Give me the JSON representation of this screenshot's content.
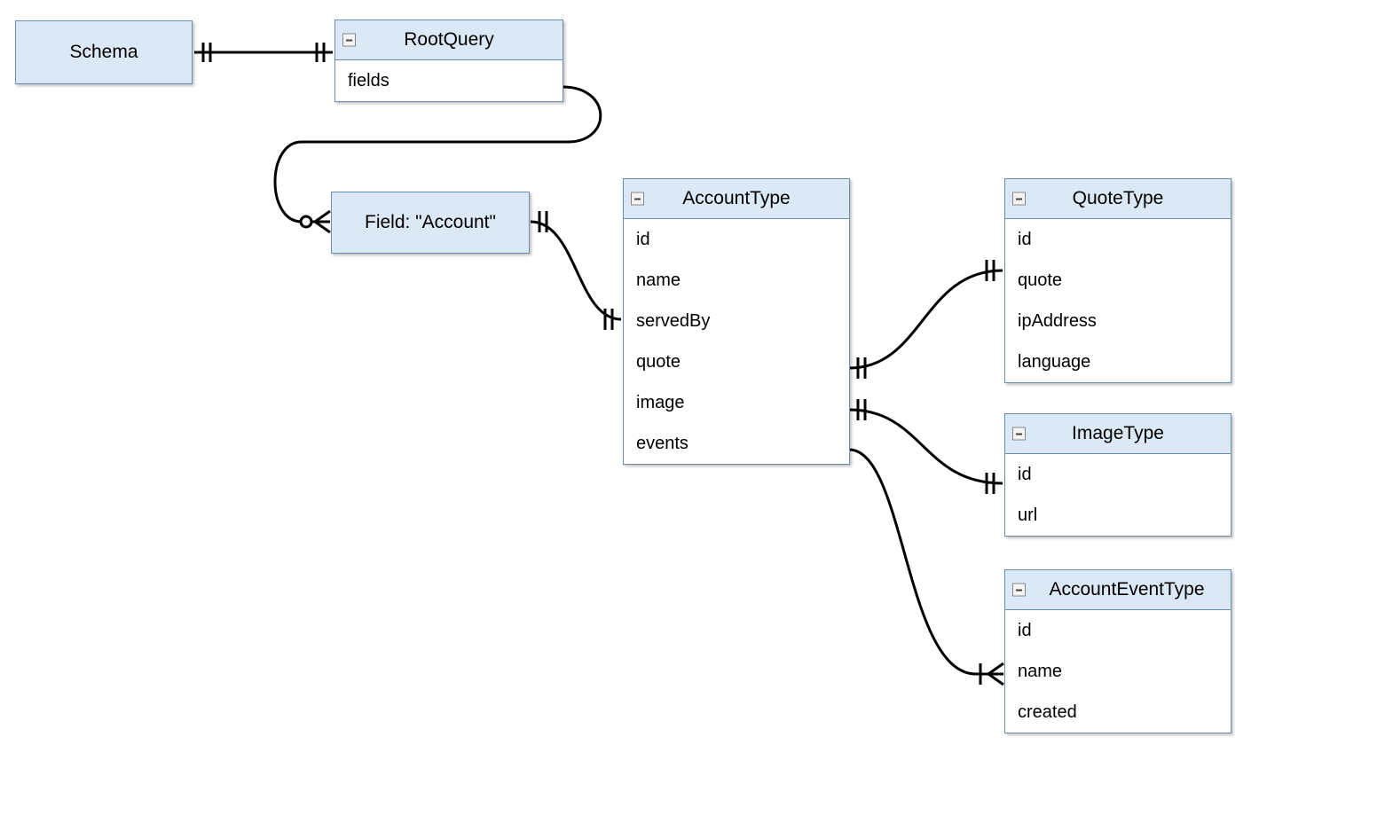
{
  "colors": {
    "fill": "#dbe8f6",
    "stroke": "#6b8cb3",
    "edge": "#000000"
  },
  "boxes": {
    "schema": {
      "title": "Schema"
    },
    "root": {
      "title": "RootQuery",
      "field": "fields"
    },
    "field": {
      "title": "Field: \"Account\""
    },
    "account": {
      "title": "AccountType",
      "fields": [
        "id",
        "name",
        "servedBy",
        "quote",
        "image",
        "events"
      ]
    },
    "quote": {
      "title": "QuoteType",
      "fields": [
        "id",
        "quote",
        "ipAddress",
        "language"
      ]
    },
    "image": {
      "title": "ImageType",
      "fields": [
        "id",
        "url"
      ]
    },
    "event": {
      "title": "AccountEventType",
      "fields": [
        "id",
        "name",
        "created"
      ]
    }
  }
}
